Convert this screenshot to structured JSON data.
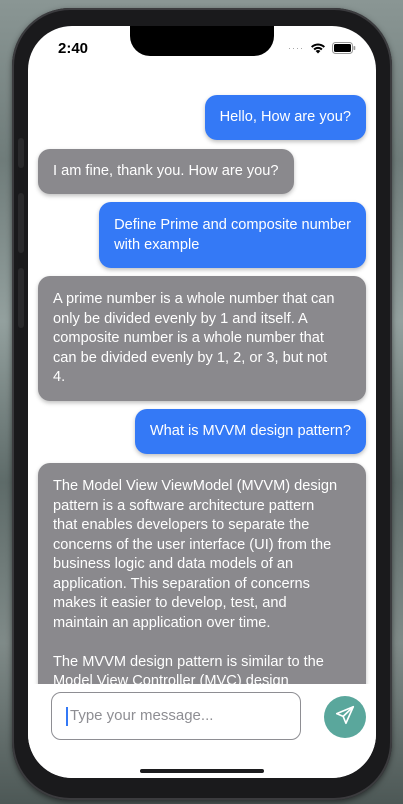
{
  "status": {
    "time": "2:40",
    "signal": "····"
  },
  "chat": {
    "messages": [
      {
        "role": "user",
        "text": "Hello, How are you?"
      },
      {
        "role": "assistant",
        "text": "I am fine, thank you. How are you?"
      },
      {
        "role": "user",
        "text": "Define Prime and composite number\nwith example"
      },
      {
        "role": "assistant",
        "text": "A prime number is a whole number that can\nonly be divided evenly by 1 and itself. A\ncomposite number is a whole number that\ncan be divided evenly by 1, 2, or 3, but not\n4."
      },
      {
        "role": "user",
        "text": "What is MVVM design pattern?"
      },
      {
        "role": "assistant",
        "text": "The Model View ViewModel (MVVM) design\npattern is a software architecture pattern\nthat enables developers to separate the\nconcerns of the user interface (UI) from the\nbusiness logic and data models of an\napplication. This separation of concerns\nmakes it easier to develop, test, and\nmaintain an application over time.\n\nThe MVVM design pattern is similar to the\nModel View Controller (MVC) design"
      }
    ]
  },
  "composer": {
    "placeholder": "Type your message..."
  },
  "colors": {
    "user_bubble": "#3479f6",
    "assistant_bubble": "#8a898d",
    "send_button": "#5aa79c"
  },
  "icons": {
    "send": "send-icon",
    "wifi": "wifi-icon",
    "battery": "battery-icon"
  }
}
